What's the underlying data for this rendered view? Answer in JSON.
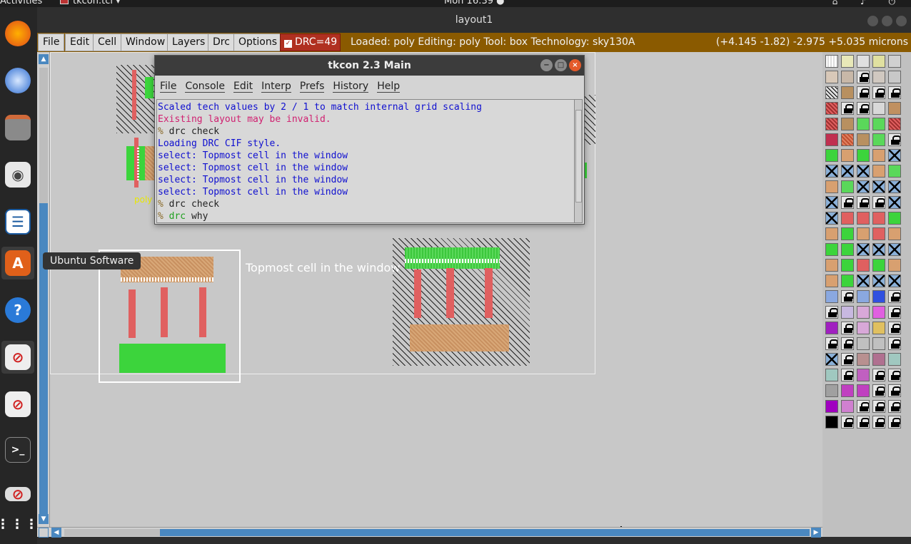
{
  "topbar": {
    "activities": "Activities",
    "app_label": "tkcon.tcl ▾",
    "clock": "Mon 16:39 ●"
  },
  "window": {
    "title": "layout1"
  },
  "dock": {
    "tooltip": "Ubuntu Software",
    "items": [
      "firefox-icon",
      "thunderbird-icon",
      "files-icon",
      "rhythmbox-icon",
      "writer-icon",
      "software-icon",
      "help-icon",
      "app-icon",
      "app-icon",
      "terminal-icon",
      "app-icon",
      "show-apps-icon"
    ]
  },
  "menubar": {
    "file": "File",
    "edit": "Edit",
    "cell": "Cell",
    "window": "Window",
    "layers": "Layers",
    "drc": "Drc",
    "options": "Options",
    "drc_badge": "DRC=49",
    "status": "Loaded: poly Editing: poly Tool: box  Technology: sky130A",
    "coords": "(+4.145 -1.82) -2.975 +5.035 microns"
  },
  "canvas": {
    "selection_label": "Topmost cell in the window",
    "poly_label": "poly"
  },
  "tkcon": {
    "title": "tkcon 2.3 Main",
    "menu": {
      "file": "File",
      "console": "Console",
      "edit": "Edit",
      "interp": "Interp",
      "prefs": "Prefs",
      "history": "History",
      "help": "Help"
    },
    "lines": [
      {
        "text": "Scaled tech values by 2 / 1 to match internal grid scaling",
        "kind": "blue"
      },
      {
        "text": "Existing layout may be invalid.",
        "kind": "red"
      },
      {
        "prompt": "% ",
        "text": "drc check",
        "kind": "cmd"
      },
      {
        "text": "Loading DRC CIF style.",
        "kind": "blue"
      },
      {
        "text": "select: Topmost cell in the window",
        "kind": "blue"
      },
      {
        "text": "select: Topmost cell in the window",
        "kind": "blue"
      },
      {
        "text": "select: Topmost cell in the window",
        "kind": "blue"
      },
      {
        "text": "select: Topmost cell in the window",
        "kind": "blue"
      },
      {
        "prompt": "% ",
        "text": "drc check",
        "kind": "cmd"
      },
      {
        "prompt": "% ",
        "cmd_word": "drc",
        "text": " why",
        "kind": "cmd-green"
      }
    ]
  },
  "palette": {
    "colors": [
      "#ffffff",
      "#e0e0a0",
      "#c0c0c0",
      "#e0e060",
      "#c0c0c0"
    ]
  }
}
